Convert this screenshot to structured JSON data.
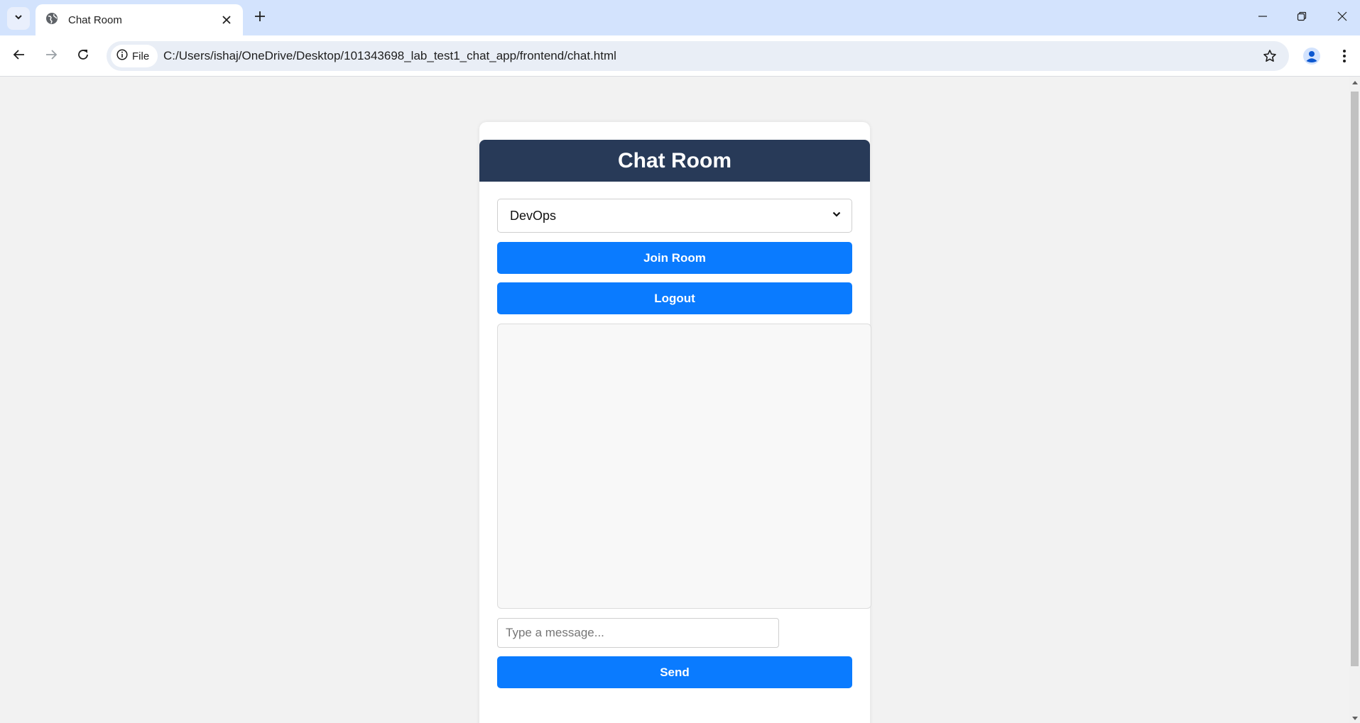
{
  "browser": {
    "tab_title": "Chat Room",
    "site_info_label": "File",
    "url": "C:/Users/ishaj/OneDrive/Desktop/101343698_lab_test1_chat_app/frontend/chat.html"
  },
  "page": {
    "title": "Chat Room",
    "room_select": {
      "selected": "DevOps"
    },
    "join_button_label": "Join Room",
    "logout_button_label": "Logout",
    "message_input_placeholder": "Type a message...",
    "send_button_label": "Send"
  },
  "colors": {
    "header_bg": "#283a58",
    "button_bg": "#0a7bff",
    "page_bg": "#f2f2f2"
  }
}
